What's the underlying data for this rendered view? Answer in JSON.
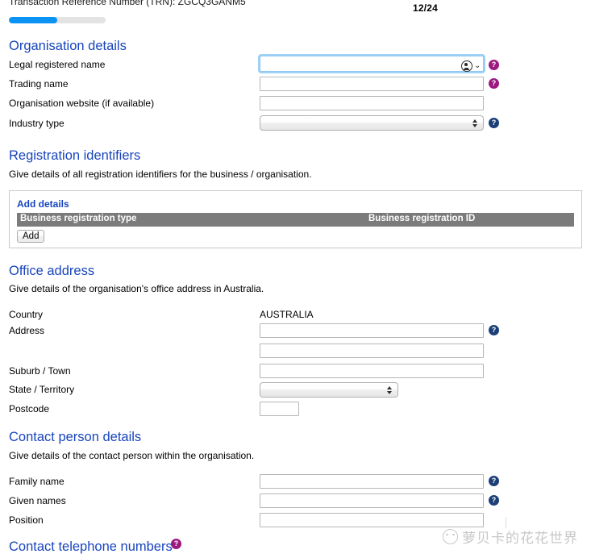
{
  "header": {
    "trn_line": "Transaction Reference Number (TRN): ZGCQ3GANM5",
    "page_counter": "12/24",
    "progress_percent": 50
  },
  "organisation_details": {
    "heading": "Organisation details",
    "fields": {
      "legal_name": {
        "label": "Legal registered name",
        "value": "",
        "help": "?"
      },
      "trading_name": {
        "label": "Trading name",
        "value": "",
        "help": "?"
      },
      "website": {
        "label": "Organisation website (if available)",
        "value": ""
      },
      "industry_type": {
        "label": "Industry type",
        "value": "",
        "help": "?"
      }
    },
    "autofill": {
      "chevron": "⌄"
    }
  },
  "registration_identifiers": {
    "heading": "Registration identifiers",
    "subtext": "Give details of all registration identifiers for the business / organisation.",
    "add_details_link": "Add details",
    "table": {
      "columns": [
        "Business registration type",
        "Business registration ID"
      ],
      "rows": []
    },
    "add_button": "Add"
  },
  "office_address": {
    "heading": "Office address",
    "subtext": "Give details of the organisation's office address in Australia.",
    "fields": {
      "country": {
        "label": "Country",
        "value": "AUSTRALIA"
      },
      "address_line1": {
        "label": "Address",
        "value": "",
        "help": "?"
      },
      "address_line2": {
        "label": "",
        "value": ""
      },
      "suburb": {
        "label": "Suburb / Town",
        "value": ""
      },
      "state": {
        "label": "State / Territory",
        "value": ""
      },
      "postcode": {
        "label": "Postcode",
        "value": ""
      }
    }
  },
  "contact_person": {
    "heading": "Contact person details",
    "subtext": "Give details of the contact person within the organisation.",
    "fields": {
      "family_name": {
        "label": "Family name",
        "value": "",
        "help": "?"
      },
      "given_names": {
        "label": "Given names",
        "value": "",
        "help": "?"
      },
      "position": {
        "label": "Position",
        "value": ""
      }
    }
  },
  "contact_phone": {
    "heading": "Contact telephone numbers",
    "help": "?"
  },
  "watermark": {
    "text": "萝贝卡的花花世界"
  },
  "colors": {
    "heading_blue": "#1845bd",
    "help_magenta": "#9c1a80",
    "help_navy": "#1c3f77",
    "progress_blue": "#0a93f5",
    "table_header_grey": "#7b7b7b",
    "focus_blue": "#8fc8f2"
  }
}
